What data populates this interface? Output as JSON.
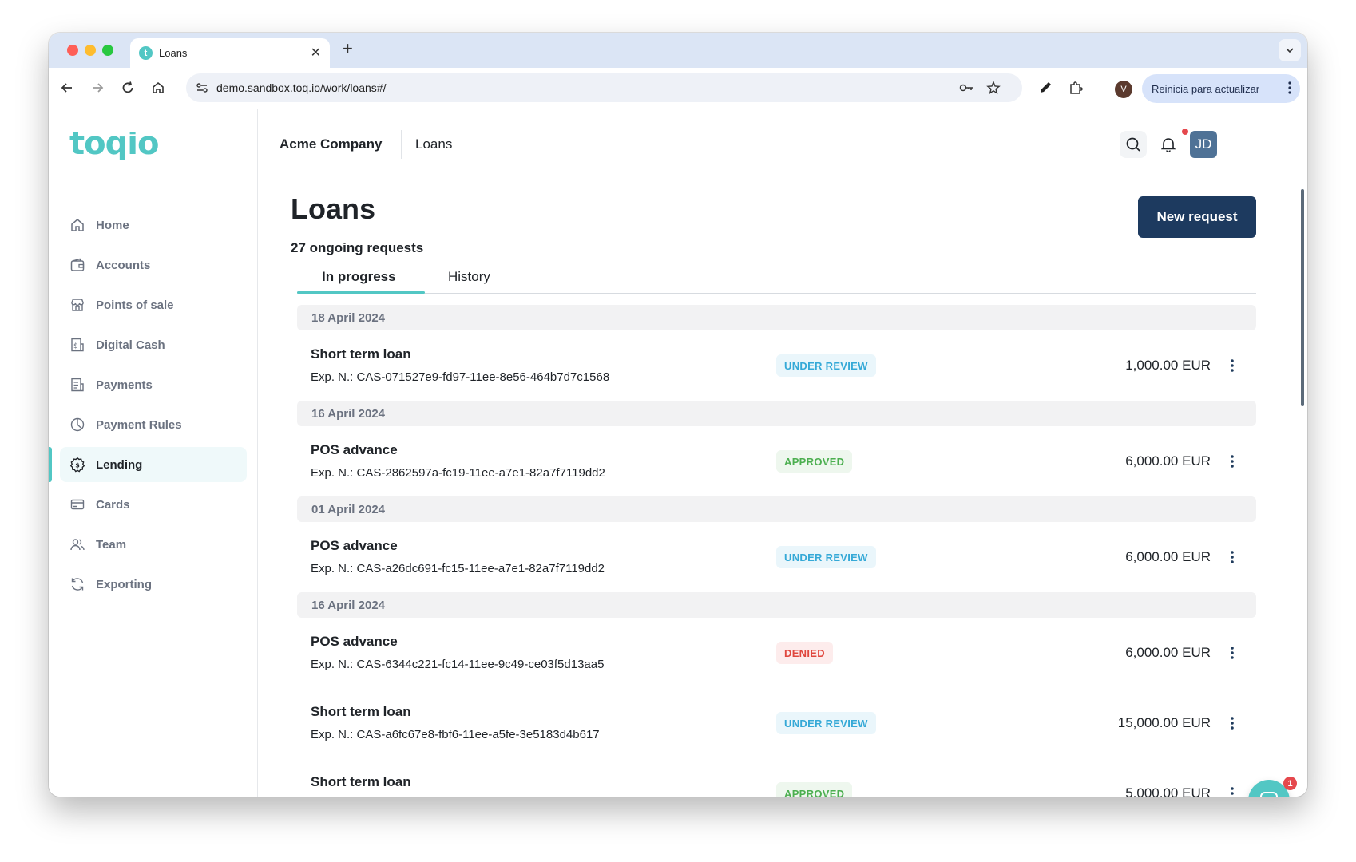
{
  "browser": {
    "tab_title": "Loans",
    "url": "demo.sandbox.toq.io/work/loans#/",
    "profile_initial": "V",
    "relaunch_label": "Reinicia para actualizar"
  },
  "app": {
    "logo_text": "toqio",
    "brand_color": "#52c7c4",
    "company": "Acme Company",
    "section": "Loans",
    "user_initials": "JD"
  },
  "sidebar": {
    "items": [
      {
        "label": "Home",
        "icon": "home-icon"
      },
      {
        "label": "Accounts",
        "icon": "wallet-icon"
      },
      {
        "label": "Points of sale",
        "icon": "store-icon"
      },
      {
        "label": "Digital Cash",
        "icon": "receipt-dollar-icon"
      },
      {
        "label": "Payments",
        "icon": "receipt-icon"
      },
      {
        "label": "Payment Rules",
        "icon": "pie-chart-icon"
      },
      {
        "label": "Lending",
        "icon": "gear-dollar-icon",
        "active": true
      },
      {
        "label": "Cards",
        "icon": "credit-card-icon"
      },
      {
        "label": "Team",
        "icon": "users-icon"
      },
      {
        "label": "Exporting",
        "icon": "refresh-icon"
      }
    ]
  },
  "page": {
    "title": "Loans",
    "subtitle": "27 ongoing requests",
    "new_request_label": "New request",
    "tabs": [
      {
        "label": "In progress",
        "active": true
      },
      {
        "label": "History",
        "active": false
      }
    ]
  },
  "loans": {
    "groups": [
      {
        "date": "18 April 2024"
      },
      {
        "date": "16 April 2024"
      },
      {
        "date": "01 April 2024"
      },
      {
        "date": "16 April 2024"
      }
    ],
    "rows": [
      {
        "title": "Short term loan",
        "ref": "Exp. N.: CAS-071527e9-fd97-11ee-8e56-464b7d7c1568",
        "status": "UNDER REVIEW",
        "amount": "1,000.00 EUR"
      },
      {
        "title": "POS advance",
        "ref": "Exp. N.: CAS-2862597a-fc19-11ee-a7e1-82a7f7119dd2",
        "status": "APPROVED",
        "amount": "6,000.00 EUR"
      },
      {
        "title": "POS advance",
        "ref": "Exp. N.: CAS-a26dc691-fc15-11ee-a7e1-82a7f7119dd2",
        "status": "UNDER REVIEW",
        "amount": "6,000.00 EUR"
      },
      {
        "title": "POS advance",
        "ref": "Exp. N.: CAS-6344c221-fc14-11ee-9c49-ce03f5d13aa5",
        "status": "DENIED",
        "amount": "6,000.00 EUR"
      },
      {
        "title": "Short term loan",
        "ref": "Exp. N.: CAS-a6fc67e8-fbf6-11ee-a5fe-3e5183d4b617",
        "status": "UNDER REVIEW",
        "amount": "15,000.00 EUR"
      },
      {
        "title": "Short term loan",
        "ref": "",
        "status": "APPROVED",
        "amount": "5,000.00 EUR"
      }
    ]
  },
  "chat": {
    "unread_count": "1"
  },
  "status_colors": {
    "under_review": "#35a9d7",
    "approved": "#4caf50",
    "denied": "#e0473e"
  }
}
